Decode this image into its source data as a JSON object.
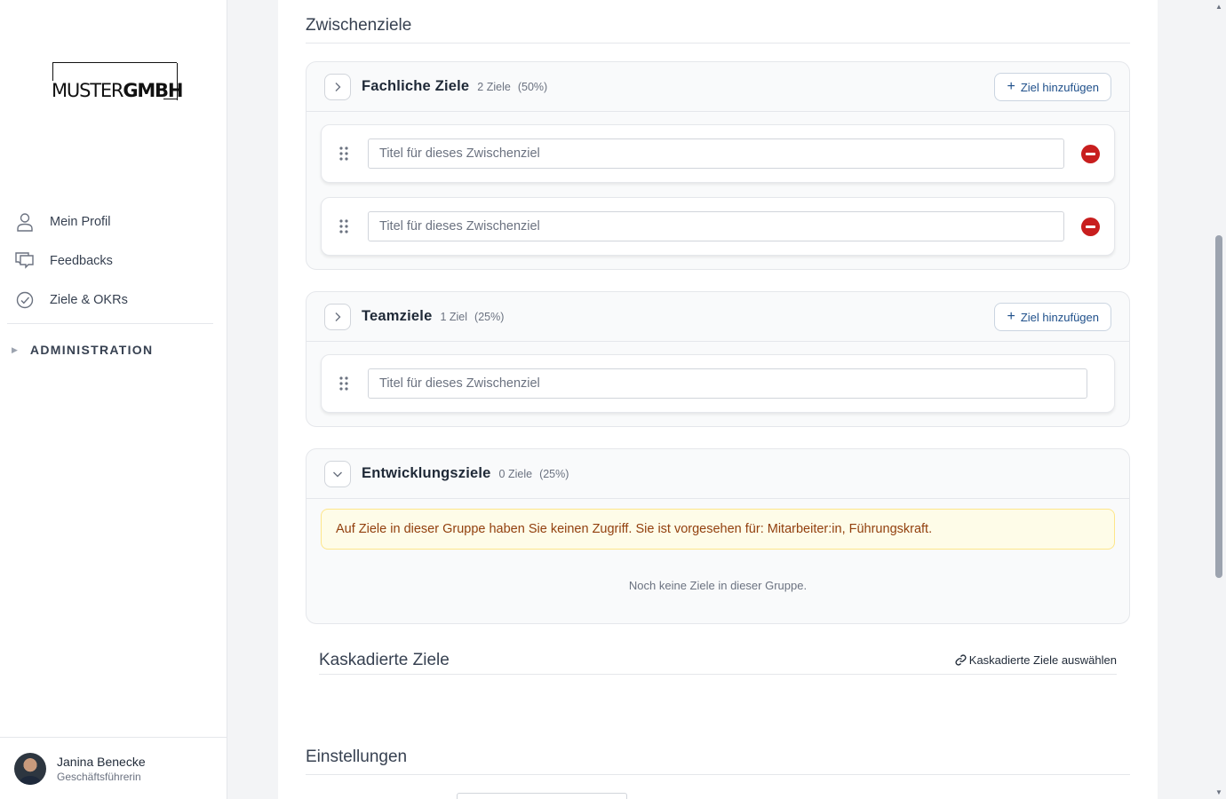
{
  "brand": {
    "logo_light": "MUSTER",
    "logo_bold": "GMBH"
  },
  "sidebar": {
    "items": [
      {
        "label": "Mein Profil",
        "icon": "user-icon"
      },
      {
        "label": "Feedbacks",
        "icon": "chat-icon"
      },
      {
        "label": "Ziele & OKRs",
        "icon": "check-circle-icon"
      }
    ],
    "admin_label": "ADMINISTRATION"
  },
  "user": {
    "name": "Janina Benecke",
    "role": "Geschäftsführerin"
  },
  "main": {
    "zwischenziele_title": "Zwischenziele",
    "groups": [
      {
        "title": "Fachliche Ziele",
        "count": "2 Ziele",
        "pct": "(50%)",
        "add_label": "Ziel hinzufügen",
        "goals": [
          {
            "placeholder": "Titel für dieses Zwischenziel"
          },
          {
            "placeholder": "Titel für dieses Zwischenziel"
          }
        ]
      },
      {
        "title": "Teamziele",
        "count": "1 Ziel",
        "pct": "(25%)",
        "add_label": "Ziel hinzufügen",
        "goals": [
          {
            "placeholder": "Titel für dieses Zwischenziel"
          }
        ]
      },
      {
        "title": "Entwicklungsziele",
        "count": "0 Ziele",
        "pct": "(25%)",
        "warning": "Auf Ziele in dieser Gruppe haben Sie keinen Zugriff. Sie ist vorgesehen für: Mitarbeiter:in, Führungskraft.",
        "empty": "Noch keine Ziele in dieser Gruppe."
      }
    ],
    "kaskadierte_title": "Kaskadierte Ziele",
    "kaskadierte_link": "Kaskadierte Ziele auswählen",
    "einstellungen_title": "Einstellungen"
  },
  "colors": {
    "accent": "#1e4f8a",
    "danger": "#c81e1e",
    "warning_bg": "#fefce8",
    "warning_text": "#92400e"
  }
}
